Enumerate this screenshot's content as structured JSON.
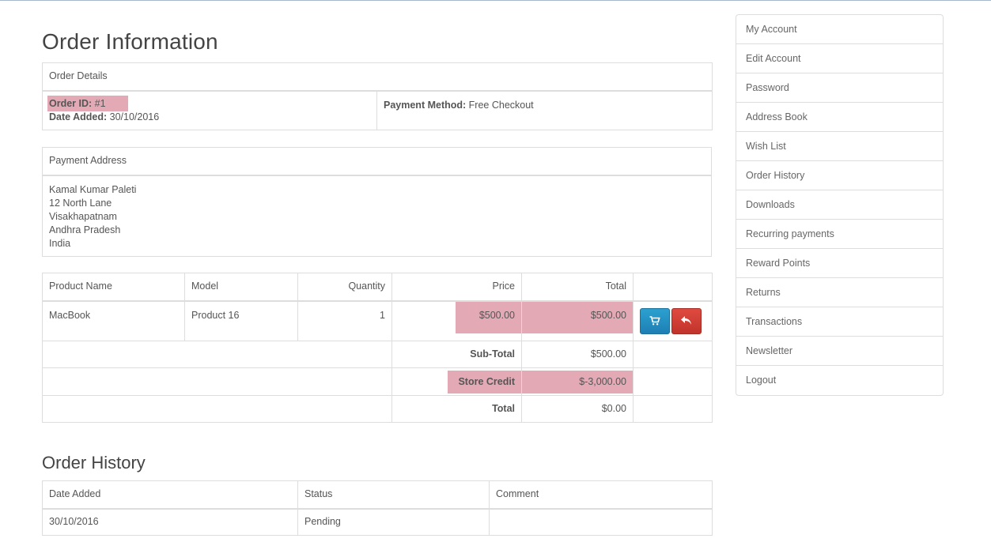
{
  "page_title": "Order Information",
  "order_details": {
    "header": "Order Details",
    "order_id_label": "Order ID:",
    "order_id_value": "#1",
    "date_added_label": "Date Added:",
    "date_added_value": "30/10/2016",
    "payment_method_label": "Payment Method:",
    "payment_method_value": "Free Checkout"
  },
  "payment_address": {
    "header": "Payment Address",
    "lines": [
      "Kamal Kumar Paleti",
      "12 North Lane",
      "Visakhapatnam",
      "Andhra Pradesh",
      "India"
    ]
  },
  "products": {
    "headers": [
      "Product Name",
      "Model",
      "Quantity",
      "Price",
      "Total",
      ""
    ],
    "rows": [
      {
        "name": "MacBook",
        "model": "Product 16",
        "quantity": "1",
        "price": "$500.00",
        "total": "$500.00"
      }
    ],
    "totals": [
      {
        "label": "Sub-Total",
        "value": "$500.00"
      },
      {
        "label": "Store Credit",
        "value": "$-3,000.00"
      },
      {
        "label": "Total",
        "value": "$0.00"
      }
    ]
  },
  "order_history": {
    "title": "Order History",
    "headers": [
      "Date Added",
      "Status",
      "Comment"
    ],
    "rows": [
      {
        "date": "30/10/2016",
        "status": "Pending",
        "comment": ""
      }
    ]
  },
  "sidebar": {
    "items": [
      "My Account",
      "Edit Account",
      "Password",
      "Address Book",
      "Wish List",
      "Order History",
      "Downloads",
      "Recurring payments",
      "Reward Points",
      "Returns",
      "Transactions",
      "Newsletter",
      "Logout"
    ]
  },
  "icons": {
    "reorder": "shopping-cart-icon",
    "return": "reply-icon"
  },
  "colors": {
    "highlight": "#e3aab5",
    "primary_button": "#2494c5",
    "danger_button": "#d0403a"
  }
}
